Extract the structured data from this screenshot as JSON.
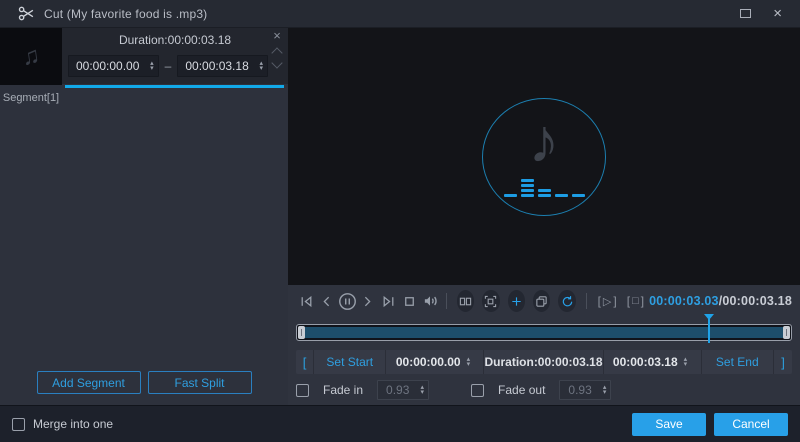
{
  "window": {
    "title": "Cut (My favorite food is .mp3)"
  },
  "icons": {
    "close": "×",
    "segment_close": "×",
    "thumb_note": "♫",
    "big_note": "♪",
    "spin_up": "▴",
    "spin_down": "▾",
    "range_dash": "–",
    "bracket_left": "[",
    "bracket_right": "]",
    "play_glyph": "▷",
    "stop_glyph": "□"
  },
  "segment_panel": {
    "label": "Segment[1]",
    "duration": "Duration:00:00:03.18",
    "start": "00:00:00.00",
    "end": "00:00:03.18",
    "add_segment": "Add Segment",
    "fast_split": "Fast Split"
  },
  "controls": {
    "current_time": "00:00:03.03",
    "total_time": "/00:00:03.18",
    "set_start": "Set Start",
    "set_end": "Set End",
    "start": "00:00:00.00",
    "end": "00:00:03.18",
    "duration": "Duration:00:00:03.18",
    "fade_in": "Fade in",
    "fade_out": "Fade out",
    "fade_in_value": "0.93",
    "fade_out_value": "0.93",
    "timeline": {
      "playhead_style": "left:83%"
    }
  },
  "footer": {
    "merge": "Merge into one",
    "save": "Save",
    "cancel": "Cancel"
  },
  "colors": {
    "accent": "#1ea2e8",
    "button_blue": "#28a0e8",
    "timeline_fill": "#1d4e6b"
  }
}
